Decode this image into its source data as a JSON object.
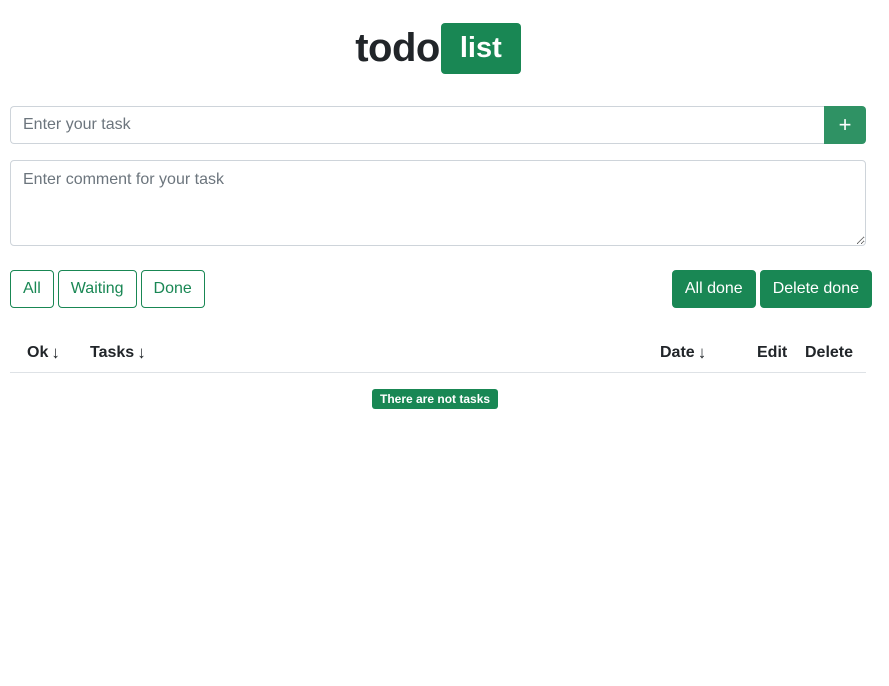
{
  "header": {
    "title_main": "todo",
    "title_badge": "list"
  },
  "task_form": {
    "task_placeholder": "Enter your task",
    "task_value": "",
    "add_button_symbol": "+",
    "comment_placeholder": "Enter comment for your task",
    "comment_value": ""
  },
  "filters": {
    "all_label": "All",
    "waiting_label": "Waiting",
    "done_label": "Done"
  },
  "actions": {
    "all_done_label": "All done",
    "delete_done_label": "Delete done"
  },
  "table": {
    "columns": [
      {
        "label": "Ok",
        "sort_arrow": "↓"
      },
      {
        "label": "Tasks",
        "sort_arrow": "↓"
      },
      {
        "label": "Date",
        "sort_arrow": "↓"
      },
      {
        "label": "Edit"
      },
      {
        "label": "Delete"
      }
    ],
    "rows": [],
    "empty_message": "There are not tasks"
  },
  "colors": {
    "accent": "#198754",
    "border": "#ced4da",
    "text": "#212529",
    "placeholder": "#6c757d"
  },
  "icons": {
    "add": "plus-icon",
    "sort": "arrow-down-icon"
  }
}
